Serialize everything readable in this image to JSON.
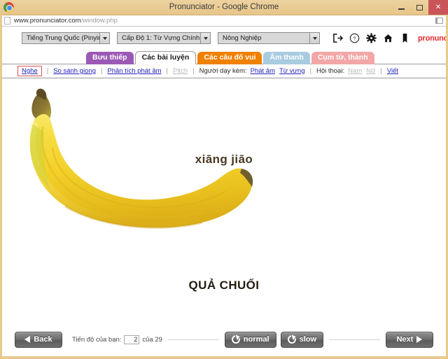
{
  "window": {
    "title": "Pronunciator - Google Chrome",
    "minimize_label": "–",
    "maximize_label": "□",
    "close_label": "✕",
    "url_domain": "www.pronunciator.com",
    "url_path": "/window.php"
  },
  "toolbar": {
    "language_select": "Tiếng Trung Quốc (Pinyin)",
    "level_select": "Cấp Độ 1: Từ Vựng Chính",
    "category_select": "Nông Nghiệp",
    "icons": [
      "exit-icon",
      "help-icon",
      "gear-icon",
      "home-icon",
      "bookmark-icon"
    ],
    "brand": "pronunciator:"
  },
  "tabs": [
    {
      "label": "Bưu thiếp",
      "color": "#9b59b6",
      "active": false
    },
    {
      "label": "Các bài luyện",
      "color": "#ffffff",
      "active": true
    },
    {
      "label": "Các câu đố vui",
      "color": "#f08000",
      "active": false
    },
    {
      "label": "Âm thanh",
      "color": "#a8cbe0",
      "active": false
    },
    {
      "label": "Cụm từ, thành",
      "color": "#f2a6a6",
      "active": false
    }
  ],
  "subnav": {
    "listen": "Nghe",
    "compare_voice": "So sánh giọng",
    "pronunciation_analysis": "Phân tích phát âm",
    "pitch": "Pitch",
    "tutor_label": "Người dạy kèm:",
    "tutor_pronunciation": "Phát âm",
    "tutor_vocabulary": "Từ vựng",
    "dialog_label": "Hội thoại:",
    "dialog_male": "Nam",
    "dialog_female": "Nữ",
    "write": "Viết"
  },
  "card": {
    "pinyin": "xiāng jiāo",
    "translation": "QUẢ CHUỐI",
    "image_name": "banana-photo"
  },
  "bottombar": {
    "back_label": "Back",
    "next_label": "Next",
    "progress_label": "Tiến độ của bạn:",
    "progress_value": "2",
    "progress_of": "của 29",
    "normal_label": "normal",
    "slow_label": "slow"
  }
}
